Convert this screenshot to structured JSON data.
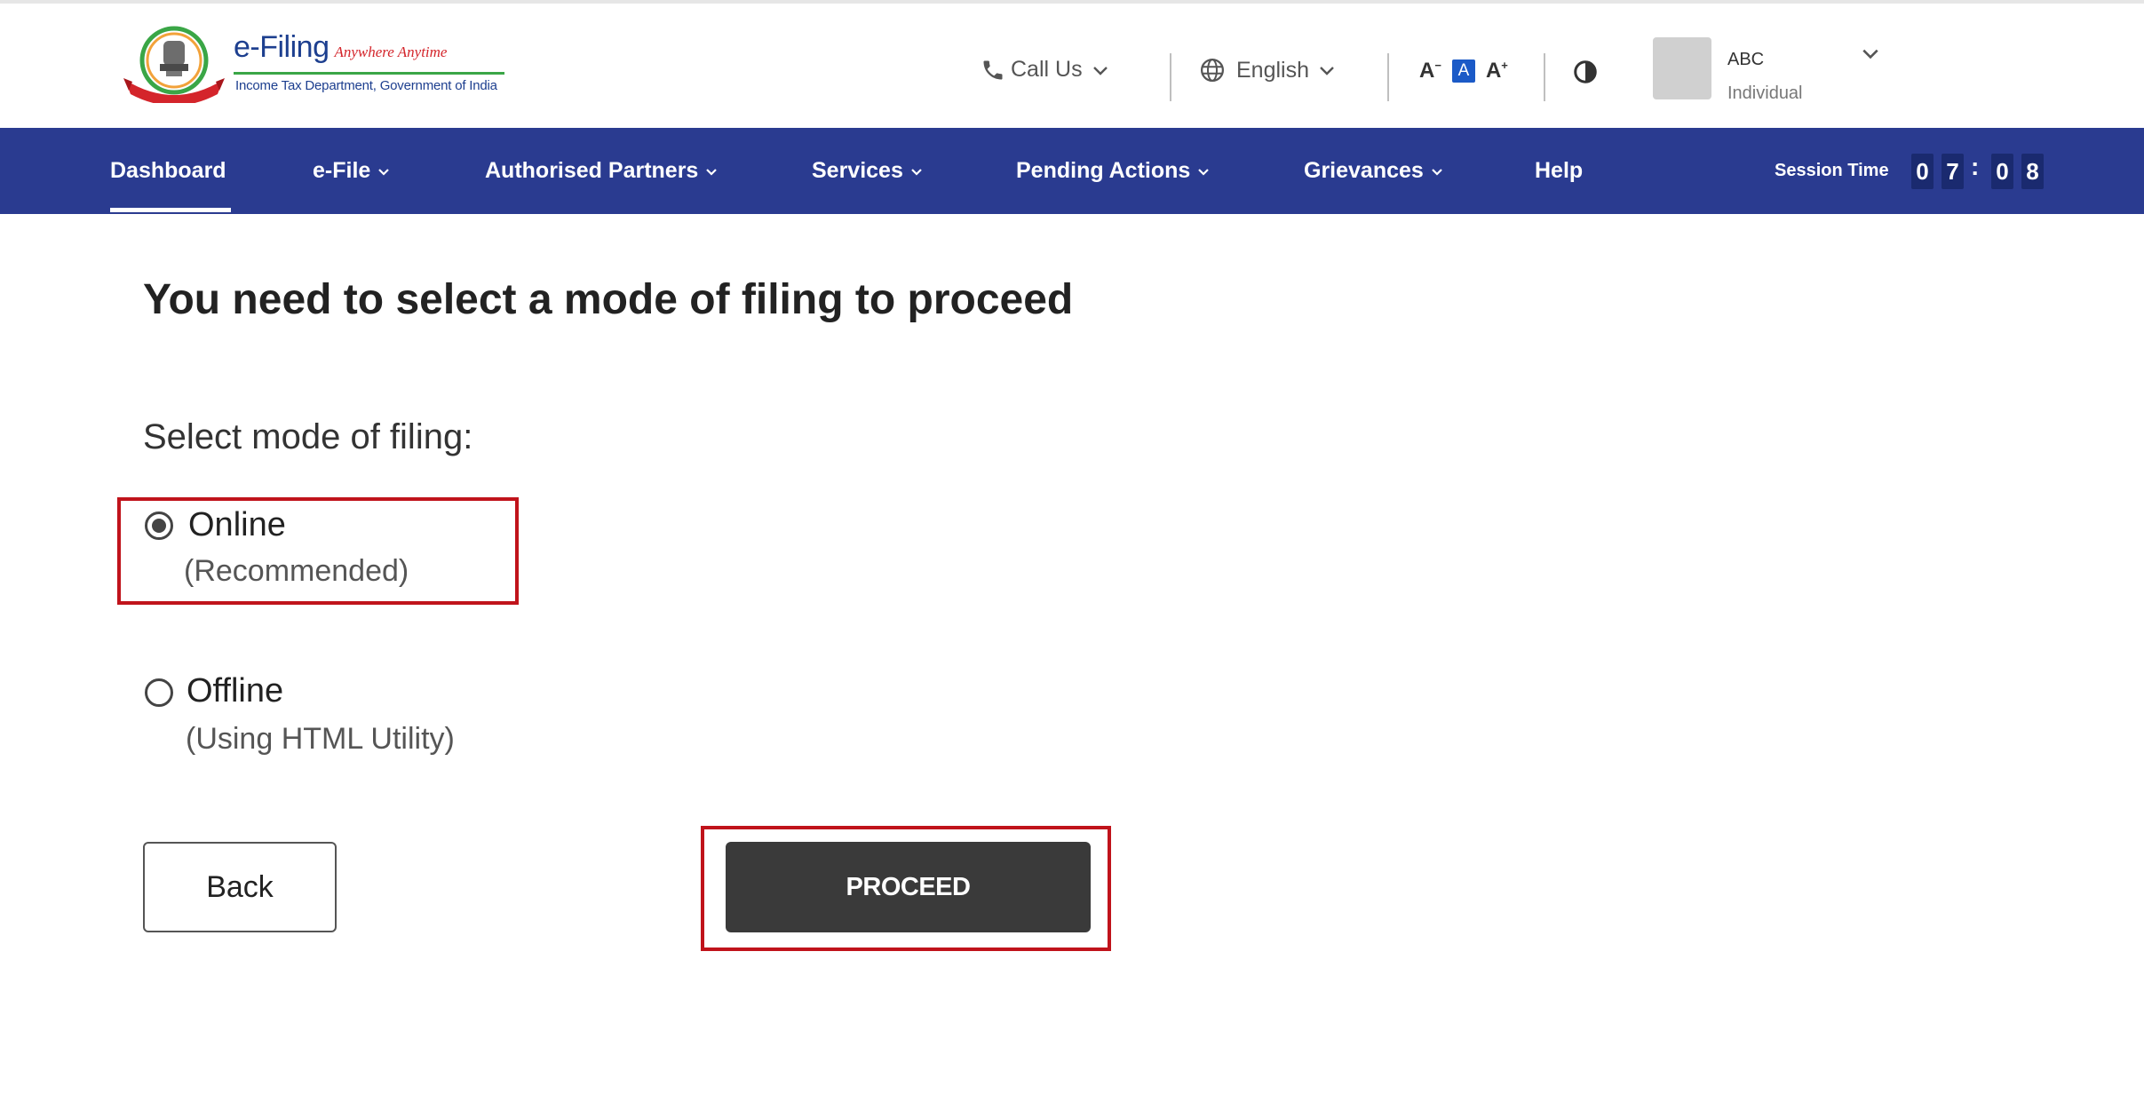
{
  "header": {
    "logo": {
      "title": "e-Filing",
      "tagline": "Anywhere Anytime",
      "subtitle": "Income Tax Department, Government of India"
    },
    "call_us": "Call Us",
    "language": "English",
    "font_controls": {
      "decrease": "A",
      "default": "A",
      "increase": "A"
    },
    "user": {
      "name": "ABC",
      "type": "Individual"
    }
  },
  "nav": {
    "items": [
      {
        "label": "Dashboard"
      },
      {
        "label": "e-File"
      },
      {
        "label": "Authorised Partners"
      },
      {
        "label": "Services"
      },
      {
        "label": "Pending Actions"
      },
      {
        "label": "Grievances"
      },
      {
        "label": "Help"
      }
    ],
    "session_label": "Session Time",
    "session_digits": [
      "0",
      "7",
      "0",
      "8"
    ],
    "session_separator": ":"
  },
  "main": {
    "title": "You need to select a mode of filing to proceed",
    "mode_label": "Select mode of filing:",
    "options": [
      {
        "label": "Online",
        "sub": "(Recommended)",
        "selected": true
      },
      {
        "label": "Offline",
        "sub": "(Using HTML Utility)",
        "selected": false
      }
    ],
    "back_label": "Back",
    "proceed_label": "PROCEED"
  },
  "colors": {
    "nav_bg": "#2a3b90",
    "highlight": "#c0131b",
    "proceed_bg": "#3a3a3a",
    "logo_blue": "#1d3f8f",
    "logo_green": "#3aa646"
  }
}
